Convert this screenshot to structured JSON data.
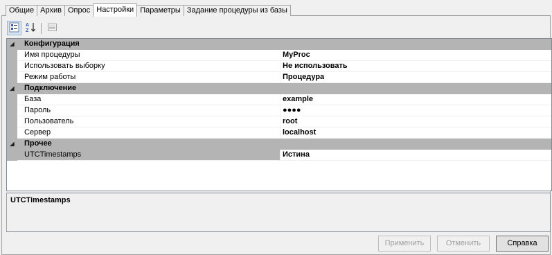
{
  "tabs": [
    {
      "label": "Общие"
    },
    {
      "label": "Архив"
    },
    {
      "label": "Опрос"
    },
    {
      "label": "Настройки",
      "active": true
    },
    {
      "label": "Параметры"
    },
    {
      "label": "Задание процедуры из базы"
    }
  ],
  "toolbar": {
    "categorized_icon": "categorized-view-icon",
    "alphabetical_icon": "sort-alphabetical-icon",
    "property_pages_icon": "property-pages-icon"
  },
  "grid": {
    "categories": [
      {
        "label": "Конфигурация",
        "properties": [
          {
            "name": "Имя процедуры",
            "value": "MyProc"
          },
          {
            "name": "Использовать выборку",
            "value": "Не использовать"
          },
          {
            "name": "Режим работы",
            "value": "Процедура"
          }
        ]
      },
      {
        "label": "Подключение",
        "properties": [
          {
            "name": "База",
            "value": "example"
          },
          {
            "name": "Пароль",
            "value": "●●●●"
          },
          {
            "name": "Пользователь",
            "value": "root"
          },
          {
            "name": "Сервер",
            "value": "localhost"
          }
        ]
      },
      {
        "label": "Прочее",
        "properties": [
          {
            "name": "UTCTimestamps",
            "value": "Истина"
          }
        ]
      }
    ]
  },
  "description": {
    "title": "UTCTimestamps"
  },
  "buttons": {
    "apply": "Применить",
    "cancel": "Отменить",
    "help": "Справка"
  }
}
